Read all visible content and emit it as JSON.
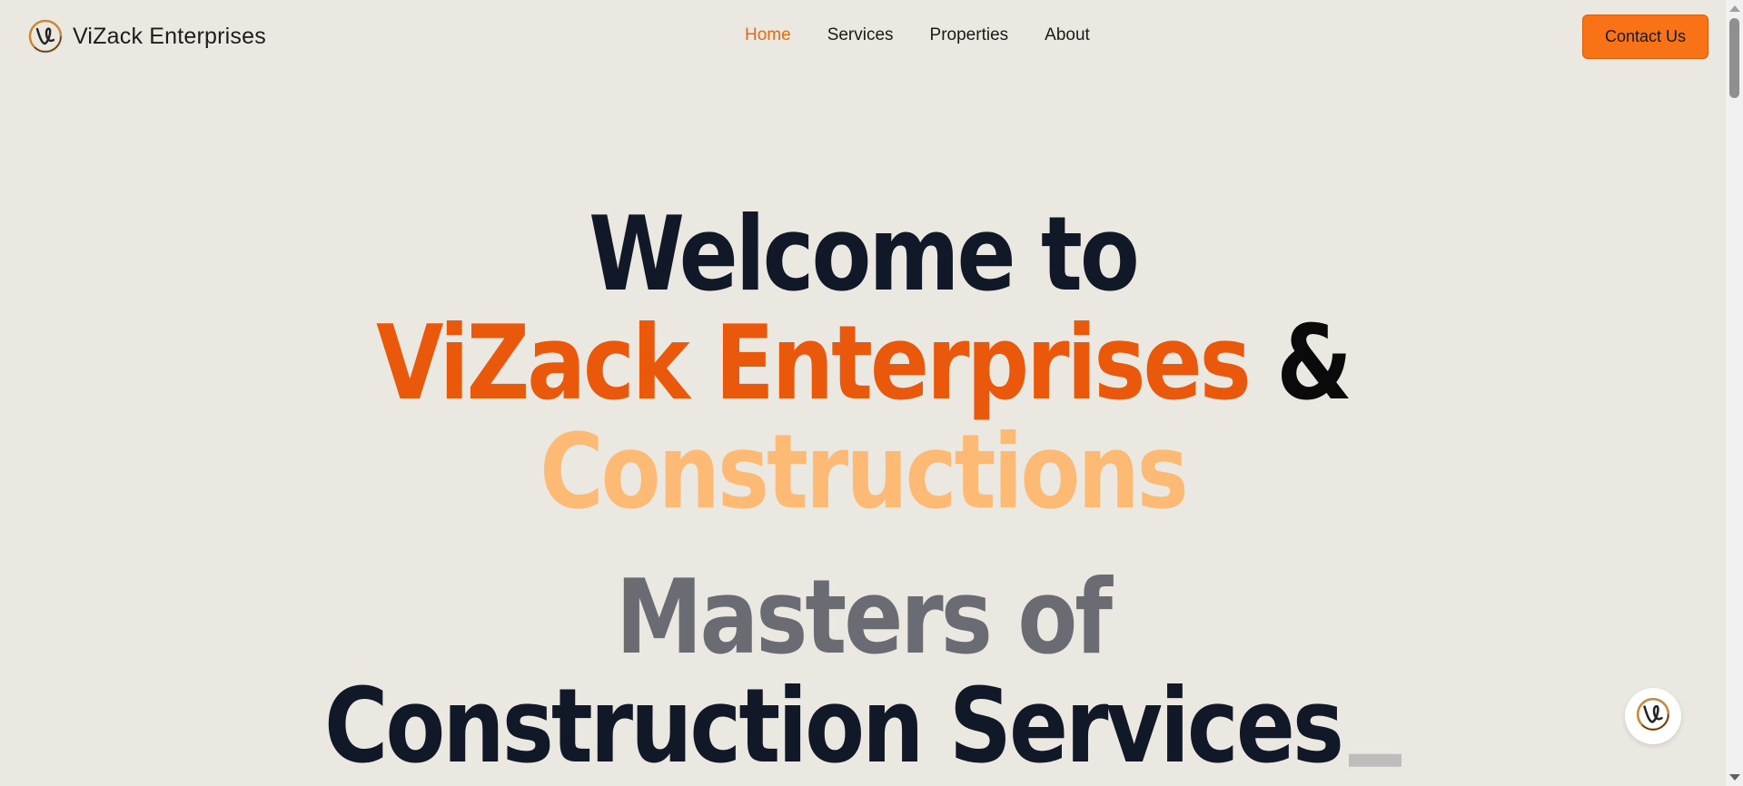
{
  "header": {
    "brand_name": "ViZack Enterprises",
    "logo_icon": "vizack-logo-icon",
    "nav": {
      "home": "Home",
      "services": "Services",
      "properties": "Properties",
      "about": "About"
    },
    "active_nav": "Home",
    "contact_label": "Contact Us"
  },
  "hero": {
    "line1": "Welcome to",
    "line2_brand": "ViZack Enterprises",
    "line2_amp": "&",
    "line3": "Constructions",
    "line4": "Masters of",
    "line5": "Construction Services"
  },
  "floating_button": {
    "icon": "vizack-logo-icon"
  },
  "colors": {
    "background": "#ebe8e2",
    "accent": "#f97316",
    "brand_orange": "#ea580c",
    "light_orange": "#fdba74",
    "dark_navy": "#111827",
    "gray": "#6b6b73"
  }
}
